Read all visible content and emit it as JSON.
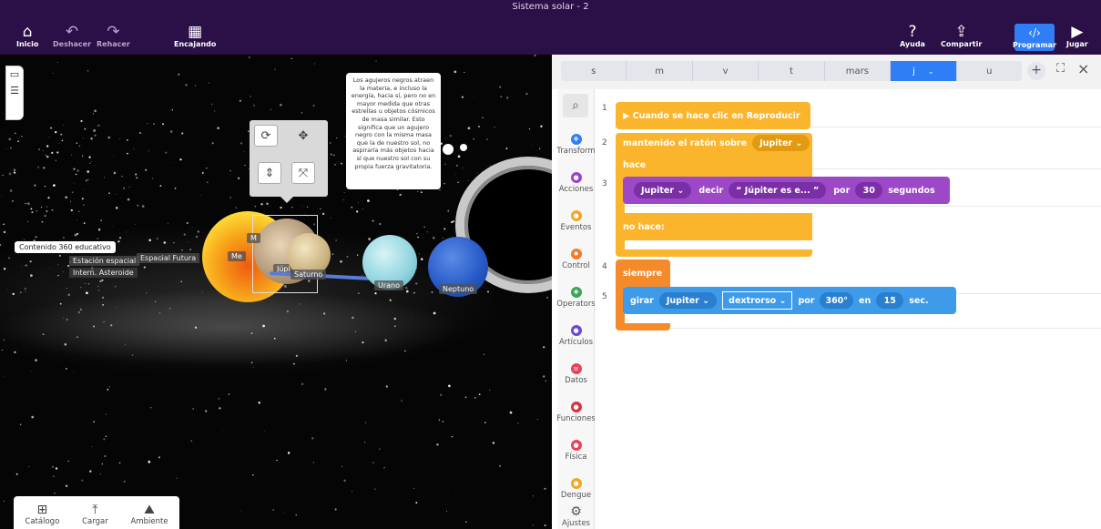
{
  "window": {
    "title": "Sistema solar - 2"
  },
  "toolbar": {
    "inicio": "Inicio",
    "deshacer": "Deshacer",
    "rehacer": "Rehacer",
    "encajando": "Encajando",
    "ayuda": "Ayuda",
    "compartir": "Compartir",
    "programar": "Programar",
    "jugar": "Jugar"
  },
  "scene": {
    "tooltip_text": "Los agujeros negros atraen la materia, e incluso la energía, hacia sí, pero no en mayor medida que otras estrellas u objetos cósmicos de masa similar. Esto significa que un agujero negro con la misma masa que la de nuestro sol, no aspiraría más objetos hacia sí que nuestro sol con su propia fuerza gravitatoria.",
    "info_360": "Contenido 360 educativo",
    "station_label": "Estación espacial",
    "futura_label": "Espacial Futura",
    "asteroid_label": "Intern.  Asteroide",
    "planet_labels": {
      "sol": "Me",
      "mercurio": "M",
      "jupiter": "Júpi",
      "saturno": "Saturno",
      "urano": "Urano",
      "neptuno": "Neptuno"
    },
    "bottom_tools": [
      "Catálogo",
      "Cargar",
      "Ambiente"
    ]
  },
  "editor": {
    "tabs": [
      "s",
      "m",
      "v",
      "t",
      "mars",
      "j",
      "u"
    ],
    "active_tab": "j",
    "categories": [
      {
        "label": "Transform",
        "color": "#2f7ef5"
      },
      {
        "label": "Acciones",
        "color": "#a142c9"
      },
      {
        "label": "Eventos",
        "color": "#f4a623"
      },
      {
        "label": "Control",
        "color": "#f07b2e"
      },
      {
        "label": "Operators",
        "color": "#3aa757"
      },
      {
        "label": "Artículos",
        "color": "#6b48d6"
      },
      {
        "label": "Datos",
        "color": "#e8425a"
      },
      {
        "label": "Funciones",
        "color": "#d93240"
      },
      {
        "label": "Física",
        "color": "#e8425a"
      },
      {
        "label": "Dengue",
        "color": "#f4a623"
      }
    ],
    "settings_label": "Ajustes",
    "line_numbers": [
      "1",
      "2",
      "3",
      "4",
      "5"
    ],
    "blocks": {
      "play_event": "▶ Cuando se hace clic en Reproducir",
      "hover": "mantenido el ratón sobre",
      "hover_target": "Jupiter",
      "hace": "hace",
      "say_target": "Jupiter",
      "say": "decir",
      "say_text": "“ Júpiter es e... ”",
      "por": "por",
      "say_seconds": "30",
      "segundos": "segundos",
      "no_hace": "no hace:",
      "siempre": "siempre",
      "girar": "girar",
      "rotate_target": "Jupiter",
      "direction": "dextrorso",
      "por2": "por",
      "degrees": "360°",
      "en": "en",
      "rotate_seconds": "15",
      "sec": "sec."
    }
  },
  "colors": {
    "topbar": "#2b0f47",
    "event_block": "#fbb52c",
    "action_block": "#9d49c7",
    "control_block": "#f58a2b",
    "transform_block": "#3d9be9",
    "accent": "#2f7ef5"
  }
}
